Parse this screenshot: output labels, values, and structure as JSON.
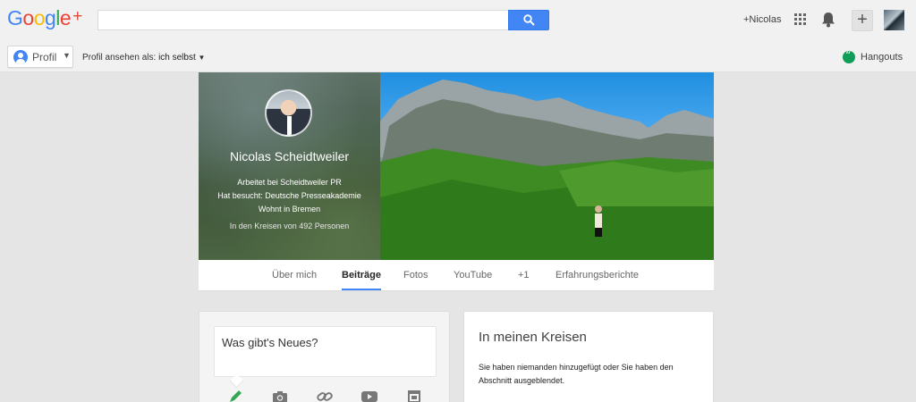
{
  "header": {
    "logo_letters": [
      "G",
      "o",
      "o",
      "g",
      "l",
      "e"
    ],
    "logo_plus": "+",
    "search_placeholder": "",
    "user_link": "+Nicolas",
    "share_label": "+"
  },
  "subbar": {
    "profile_button_label": "Profil",
    "view_as_prefix": "Profil ansehen als:",
    "view_as_value": "ich selbst",
    "hangouts_label": "Hangouts"
  },
  "cover": {
    "name": "Nicolas Scheidtweiler",
    "info_lines": [
      "Arbeitet bei Scheidtweiler PR",
      "Hat besucht: Deutsche Presseakademie",
      "Wohnt in Bremen"
    ],
    "circles_count_text": "In den Kreisen von 492 Personen"
  },
  "tabs": [
    {
      "label": "Über mich",
      "active": false
    },
    {
      "label": "Beiträge",
      "active": true
    },
    {
      "label": "Fotos",
      "active": false
    },
    {
      "label": "YouTube",
      "active": false
    },
    {
      "label": "+1",
      "active": false
    },
    {
      "label": "Erfahrungsberichte",
      "active": false
    }
  ],
  "share_box": {
    "placeholder": "Was gibt's Neues?",
    "tools": [
      "pencil-icon",
      "camera-icon",
      "link-icon",
      "video-icon",
      "event-icon"
    ]
  },
  "circles_card": {
    "title": "In meinen Kreisen",
    "text": "Sie haben niemanden hinzugefügt oder Sie haben den Abschnitt ausgeblendet."
  },
  "colors": {
    "accent": "#4285f4",
    "hangouts_green": "#0f9d58",
    "pencil_green": "#34a853"
  }
}
